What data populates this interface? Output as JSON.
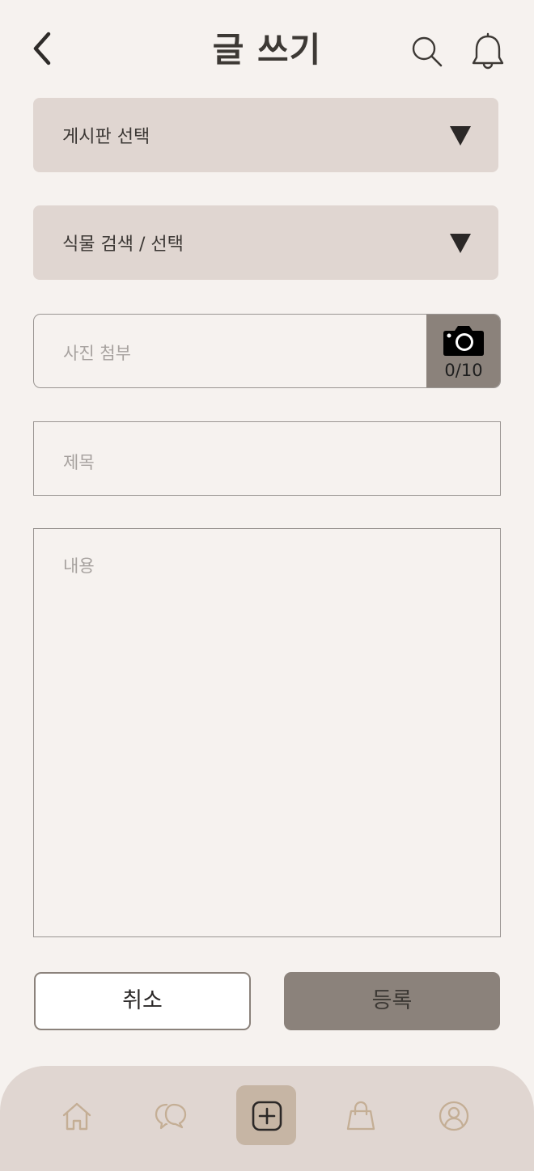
{
  "header": {
    "title": "글 쓰기"
  },
  "form": {
    "board_select_label": "게시판 선택",
    "plant_select_label": "식물 검색 / 선택",
    "photo_placeholder": "사진 첨부",
    "photo_count": "0/10",
    "title_placeholder": "제목",
    "content_placeholder": "내용"
  },
  "actions": {
    "cancel_label": "취소",
    "submit_label": "등록"
  },
  "bottom_nav": {
    "items": [
      {
        "icon": "home-icon"
      },
      {
        "icon": "chat-icon"
      },
      {
        "icon": "write-icon",
        "active": true
      },
      {
        "icon": "shopping-bag-icon"
      },
      {
        "icon": "profile-icon"
      }
    ]
  },
  "colors": {
    "background": "#f6f2ef",
    "select_bg": "#e0d6d1",
    "accent": "#8b827b",
    "nav_active": "#c6b5a4",
    "nav_icon": "#c4ae95"
  }
}
